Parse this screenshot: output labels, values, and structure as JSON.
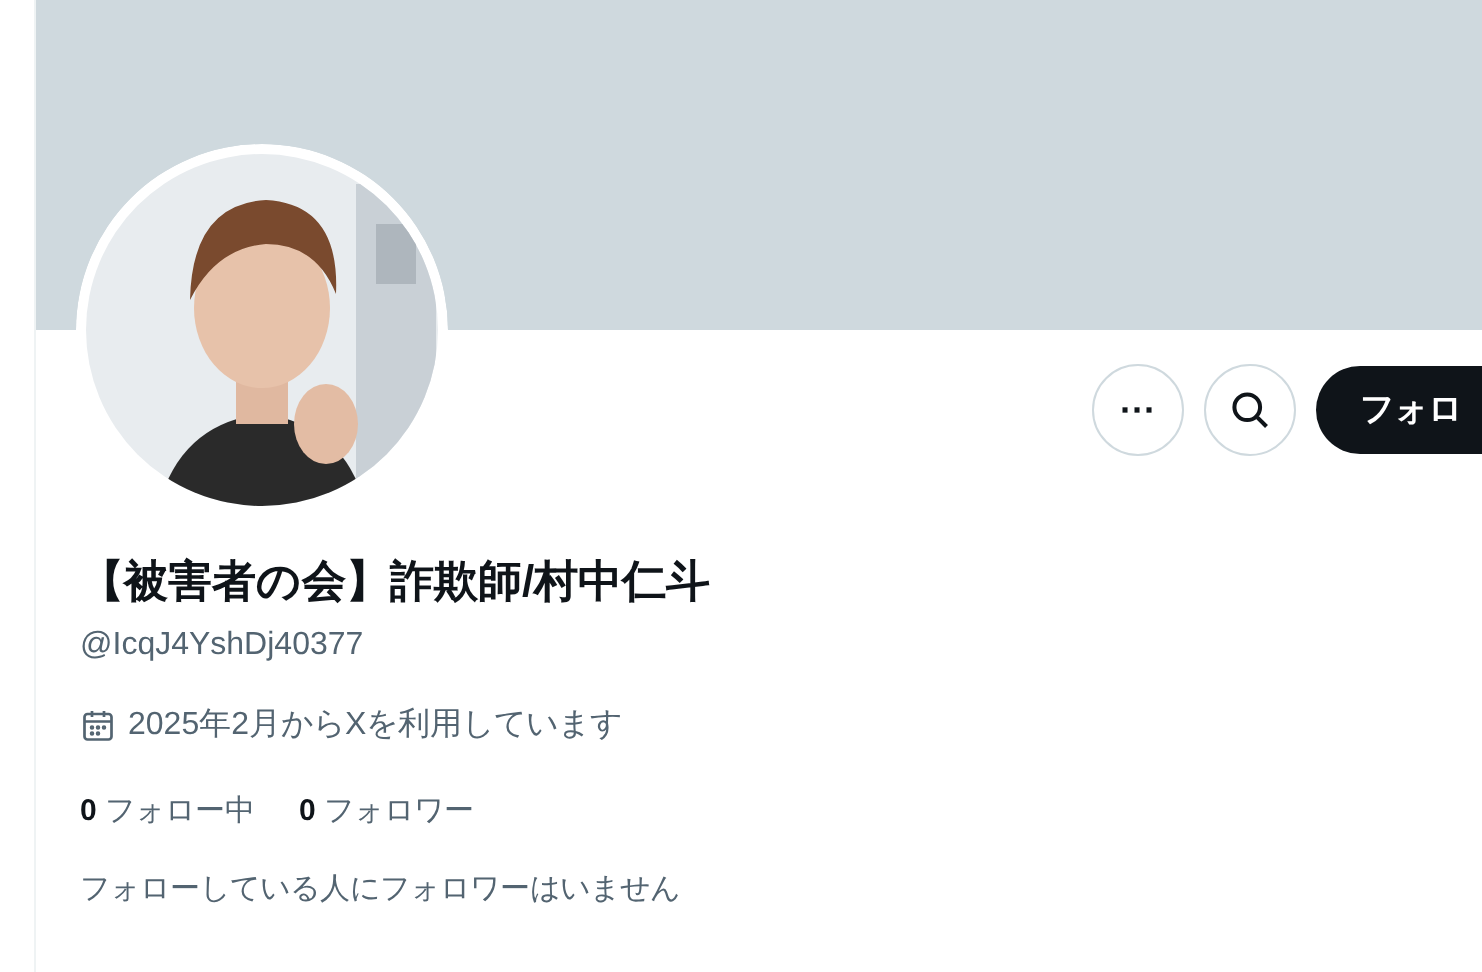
{
  "profile": {
    "name": "【被害者の会】詐欺師/村中仁斗",
    "handle": "@IcqJ4YshDj40377",
    "joined": "2025年2月からXを利用しています",
    "stats": [
      {
        "count": "0",
        "label": "フォロー中"
      },
      {
        "count": "0",
        "label": "フォロワー"
      }
    ],
    "followers_note": "フォローしている人にフォロワーはいません"
  },
  "actions": {
    "more": "···",
    "follow": "フォロ"
  }
}
